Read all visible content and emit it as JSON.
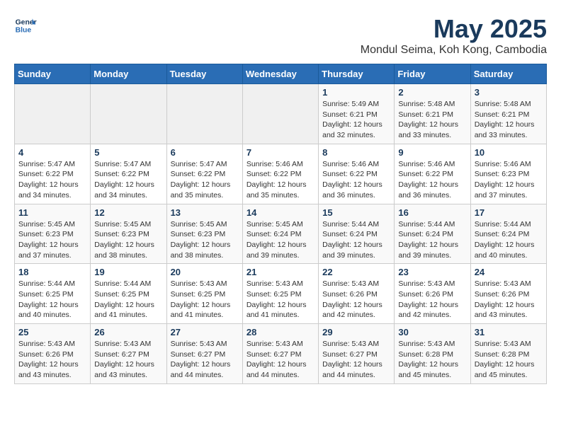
{
  "header": {
    "logo_line1": "General",
    "logo_line2": "Blue",
    "title": "May 2025",
    "subtitle": "Mondul Seima, Koh Kong, Cambodia"
  },
  "days_of_week": [
    "Sunday",
    "Monday",
    "Tuesday",
    "Wednesday",
    "Thursday",
    "Friday",
    "Saturday"
  ],
  "weeks": [
    [
      {
        "day": "",
        "info": ""
      },
      {
        "day": "",
        "info": ""
      },
      {
        "day": "",
        "info": ""
      },
      {
        "day": "",
        "info": ""
      },
      {
        "day": "1",
        "info": "Sunrise: 5:49 AM\nSunset: 6:21 PM\nDaylight: 12 hours\nand 32 minutes."
      },
      {
        "day": "2",
        "info": "Sunrise: 5:48 AM\nSunset: 6:21 PM\nDaylight: 12 hours\nand 33 minutes."
      },
      {
        "day": "3",
        "info": "Sunrise: 5:48 AM\nSunset: 6:21 PM\nDaylight: 12 hours\nand 33 minutes."
      }
    ],
    [
      {
        "day": "4",
        "info": "Sunrise: 5:47 AM\nSunset: 6:22 PM\nDaylight: 12 hours\nand 34 minutes."
      },
      {
        "day": "5",
        "info": "Sunrise: 5:47 AM\nSunset: 6:22 PM\nDaylight: 12 hours\nand 34 minutes."
      },
      {
        "day": "6",
        "info": "Sunrise: 5:47 AM\nSunset: 6:22 PM\nDaylight: 12 hours\nand 35 minutes."
      },
      {
        "day": "7",
        "info": "Sunrise: 5:46 AM\nSunset: 6:22 PM\nDaylight: 12 hours\nand 35 minutes."
      },
      {
        "day": "8",
        "info": "Sunrise: 5:46 AM\nSunset: 6:22 PM\nDaylight: 12 hours\nand 36 minutes."
      },
      {
        "day": "9",
        "info": "Sunrise: 5:46 AM\nSunset: 6:22 PM\nDaylight: 12 hours\nand 36 minutes."
      },
      {
        "day": "10",
        "info": "Sunrise: 5:46 AM\nSunset: 6:23 PM\nDaylight: 12 hours\nand 37 minutes."
      }
    ],
    [
      {
        "day": "11",
        "info": "Sunrise: 5:45 AM\nSunset: 6:23 PM\nDaylight: 12 hours\nand 37 minutes."
      },
      {
        "day": "12",
        "info": "Sunrise: 5:45 AM\nSunset: 6:23 PM\nDaylight: 12 hours\nand 38 minutes."
      },
      {
        "day": "13",
        "info": "Sunrise: 5:45 AM\nSunset: 6:23 PM\nDaylight: 12 hours\nand 38 minutes."
      },
      {
        "day": "14",
        "info": "Sunrise: 5:45 AM\nSunset: 6:24 PM\nDaylight: 12 hours\nand 39 minutes."
      },
      {
        "day": "15",
        "info": "Sunrise: 5:44 AM\nSunset: 6:24 PM\nDaylight: 12 hours\nand 39 minutes."
      },
      {
        "day": "16",
        "info": "Sunrise: 5:44 AM\nSunset: 6:24 PM\nDaylight: 12 hours\nand 39 minutes."
      },
      {
        "day": "17",
        "info": "Sunrise: 5:44 AM\nSunset: 6:24 PM\nDaylight: 12 hours\nand 40 minutes."
      }
    ],
    [
      {
        "day": "18",
        "info": "Sunrise: 5:44 AM\nSunset: 6:25 PM\nDaylight: 12 hours\nand 40 minutes."
      },
      {
        "day": "19",
        "info": "Sunrise: 5:44 AM\nSunset: 6:25 PM\nDaylight: 12 hours\nand 41 minutes."
      },
      {
        "day": "20",
        "info": "Sunrise: 5:43 AM\nSunset: 6:25 PM\nDaylight: 12 hours\nand 41 minutes."
      },
      {
        "day": "21",
        "info": "Sunrise: 5:43 AM\nSunset: 6:25 PM\nDaylight: 12 hours\nand 41 minutes."
      },
      {
        "day": "22",
        "info": "Sunrise: 5:43 AM\nSunset: 6:26 PM\nDaylight: 12 hours\nand 42 minutes."
      },
      {
        "day": "23",
        "info": "Sunrise: 5:43 AM\nSunset: 6:26 PM\nDaylight: 12 hours\nand 42 minutes."
      },
      {
        "day": "24",
        "info": "Sunrise: 5:43 AM\nSunset: 6:26 PM\nDaylight: 12 hours\nand 43 minutes."
      }
    ],
    [
      {
        "day": "25",
        "info": "Sunrise: 5:43 AM\nSunset: 6:26 PM\nDaylight: 12 hours\nand 43 minutes."
      },
      {
        "day": "26",
        "info": "Sunrise: 5:43 AM\nSunset: 6:27 PM\nDaylight: 12 hours\nand 43 minutes."
      },
      {
        "day": "27",
        "info": "Sunrise: 5:43 AM\nSunset: 6:27 PM\nDaylight: 12 hours\nand 44 minutes."
      },
      {
        "day": "28",
        "info": "Sunrise: 5:43 AM\nSunset: 6:27 PM\nDaylight: 12 hours\nand 44 minutes."
      },
      {
        "day": "29",
        "info": "Sunrise: 5:43 AM\nSunset: 6:27 PM\nDaylight: 12 hours\nand 44 minutes."
      },
      {
        "day": "30",
        "info": "Sunrise: 5:43 AM\nSunset: 6:28 PM\nDaylight: 12 hours\nand 45 minutes."
      },
      {
        "day": "31",
        "info": "Sunrise: 5:43 AM\nSunset: 6:28 PM\nDaylight: 12 hours\nand 45 minutes."
      }
    ]
  ]
}
